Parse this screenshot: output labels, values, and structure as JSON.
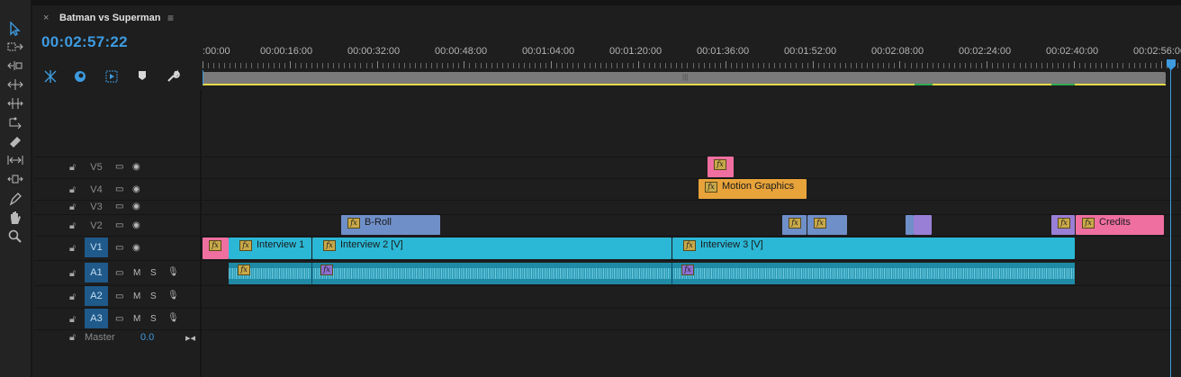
{
  "sequence": {
    "title": "Batman vs Superman",
    "close_glyph": "×",
    "menu_glyph": "≡",
    "timecode": "00:02:57:22"
  },
  "ruler": {
    "labels": [
      ":00:00",
      "00:00:16:00",
      "00:00:32:00",
      "00:00:48:00",
      "00:01:04:00",
      "00:01:20:00",
      "00:01:36:00",
      "00:01:52:00",
      "00:02:08:00",
      "00:02:24:00",
      "00:02:40:00",
      "00:02:56:00"
    ]
  },
  "tracks": {
    "video": [
      {
        "name": "V5",
        "targeted": false
      },
      {
        "name": "V4",
        "targeted": false
      },
      {
        "name": "V3",
        "targeted": false
      },
      {
        "name": "V2",
        "targeted": false
      },
      {
        "name": "V1",
        "targeted": true
      }
    ],
    "audio": [
      {
        "name": "A1",
        "targeted": true,
        "m": "M",
        "s": "S"
      },
      {
        "name": "A2",
        "targeted": true,
        "m": "M",
        "s": "S"
      },
      {
        "name": "A3",
        "targeted": true,
        "m": "M",
        "s": "S"
      }
    ],
    "master": {
      "label": "Master",
      "value": "0.0"
    }
  },
  "clips": {
    "motion_graphics": "Motion Graphics",
    "broll": "B-Roll",
    "credits": "Credits",
    "interview1": "Interview 1",
    "interview2": "Interview 2 [V]",
    "interview3": "Interview 3 [V]",
    "fx": "fx"
  },
  "colors": {
    "accent": "#3d9be0",
    "video_clip": "#2bb8d6",
    "broll_clip": "#6f8fc9",
    "motion_clip": "#e8a33a",
    "pink_clip": "#ef6fa0",
    "purple_clip": "#9a7fd6"
  },
  "icons": {
    "tools": [
      "selection-tool-icon",
      "track-select-icon",
      "ripple-edit-icon",
      "rolling-edit-icon",
      "rate-stretch-icon",
      "razor-icon",
      "slip-icon",
      "slide-icon",
      "pen-icon",
      "hand-icon",
      "zoom-icon"
    ],
    "controls": [
      "snap-icon",
      "linked-selection-icon",
      "add-marker-icon",
      "marker-icon",
      "wrench-icon"
    ]
  }
}
